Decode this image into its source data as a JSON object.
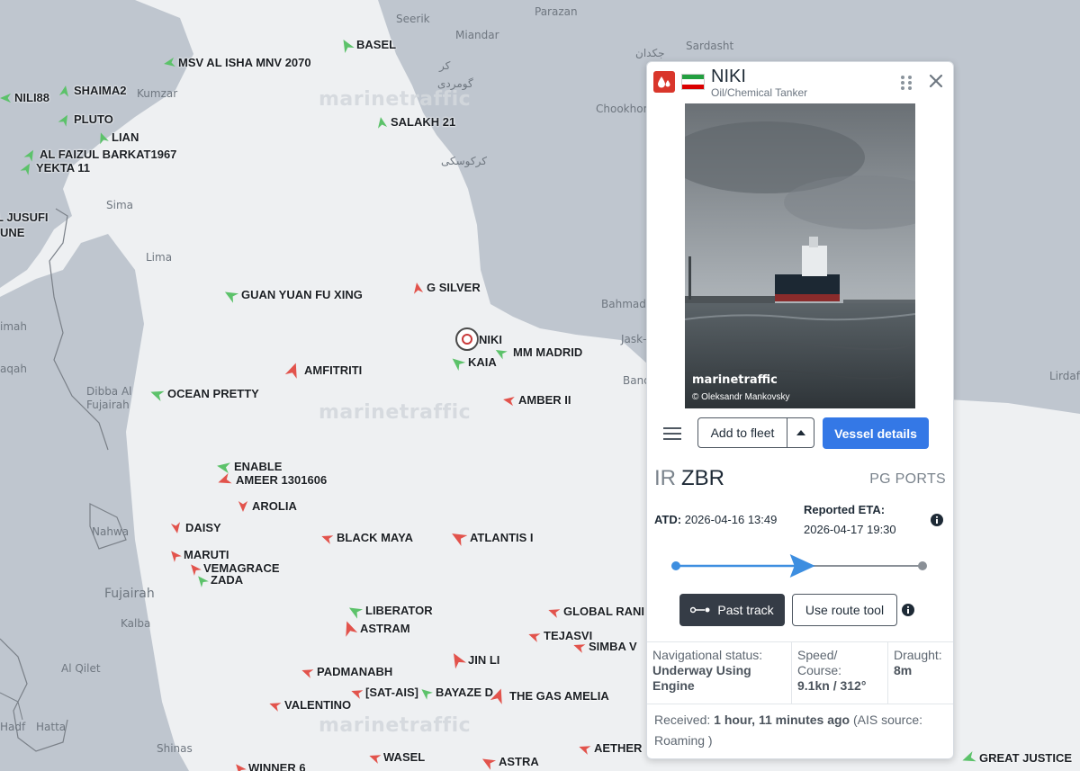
{
  "map": {
    "watermark_text": "marinetraffic",
    "places": [
      {
        "id": "seerik",
        "text": "Seerik"
      },
      {
        "id": "parazan",
        "text": "Parazan"
      },
      {
        "id": "miandar",
        "text": "Miandar"
      },
      {
        "id": "sardasht",
        "text": "Sardasht"
      },
      {
        "id": "jakdan",
        "text": "جکدان"
      },
      {
        "id": "kar",
        "text": "کر"
      },
      {
        "id": "goomardi",
        "text": "گومردی"
      },
      {
        "id": "kumzar",
        "text": "Kumzar"
      },
      {
        "id": "chookhon",
        "text": "Chookhon"
      },
      {
        "id": "kargasi",
        "text": "کرکوسکی"
      },
      {
        "id": "sima",
        "text": "Sima"
      },
      {
        "id": "lima",
        "text": "Lima"
      },
      {
        "id": "bahmadi",
        "text": "Bahmadi"
      },
      {
        "id": "jask",
        "text": "Jask-e"
      },
      {
        "id": "bande",
        "text": "Bande"
      },
      {
        "id": "lirdaf",
        "text": "Lirdaf"
      },
      {
        "id": "imah",
        "text": "imah"
      },
      {
        "id": "aqah",
        "text": "aqah"
      },
      {
        "id": "dibba",
        "text": "Dibba Al"
      },
      {
        "id": "dibba2",
        "text": "Fujairah"
      },
      {
        "id": "nahwa",
        "text": "Nahwa"
      },
      {
        "id": "fujairah",
        "text": "Fujairah"
      },
      {
        "id": "kalba",
        "text": "Kalba"
      },
      {
        "id": "alqilet",
        "text": "Al Qilet"
      },
      {
        "id": "hadf",
        "text": "Hadf"
      },
      {
        "id": "hatta",
        "text": "Hatta"
      },
      {
        "id": "shinas",
        "text": "Shinas"
      }
    ],
    "vessels": [
      {
        "name": "BASEL",
        "color": "#5cc26a"
      },
      {
        "name": "MSV AL ISHA MNV 2070",
        "color": "#5cc26a"
      },
      {
        "name": "NILI88",
        "color": "#5cc26a"
      },
      {
        "name": "SHAIMA2",
        "color": "#5cc26a"
      },
      {
        "name": "PLUTO",
        "color": "#5cc26a"
      },
      {
        "name": "LIAN",
        "color": "#5cc26a"
      },
      {
        "name": "AL FAIZUL BARKAT1967",
        "color": "#5cc26a"
      },
      {
        "name": "YEKTA 11",
        "color": "#5cc26a"
      },
      {
        "name": "SALAKH 21",
        "color": "#5cc26a"
      },
      {
        "name": "L JUSUFI",
        "color": "#5cc26a"
      },
      {
        "name": "UNE",
        "color": "#5cc26a"
      },
      {
        "name": "GUAN YUAN FU XING",
        "color": "#5cc26a"
      },
      {
        "name": "G SILVER",
        "color": "#e2534c"
      },
      {
        "name": "NIKI",
        "color": "#e2534c"
      },
      {
        "name": "MM MADRID",
        "color": "#5cc26a"
      },
      {
        "name": "KAIA",
        "color": "#5cc26a"
      },
      {
        "name": "AMFITRITI",
        "color": "#e2534c"
      },
      {
        "name": "OCEAN PRETTY",
        "color": "#5cc26a"
      },
      {
        "name": "AMBER II",
        "color": "#e2534c"
      },
      {
        "name": "ENABLE",
        "color": "#5cc26a"
      },
      {
        "name": "AMEER 1301606",
        "color": "#5cc26a"
      },
      {
        "name": "AROLIA",
        "color": "#e2534c"
      },
      {
        "name": "DAISY",
        "color": "#e2534c"
      },
      {
        "name": "BLACK MAYA",
        "color": "#e2534c"
      },
      {
        "name": "ATLANTIS I",
        "color": "#e2534c"
      },
      {
        "name": "MARUTI",
        "color": "#e2534c"
      },
      {
        "name": "VEMAGRACE",
        "color": "#e2534c"
      },
      {
        "name": "ZADA",
        "color": "#5cc26a"
      },
      {
        "name": "LIBERATOR",
        "color": "#5cc26a"
      },
      {
        "name": "GLOBAL RANI",
        "color": "#e2534c"
      },
      {
        "name": "ASTRAM",
        "color": "#e2534c"
      },
      {
        "name": "TEJASVI",
        "color": "#e2534c"
      },
      {
        "name": "SIMBA V",
        "color": "#e2534c"
      },
      {
        "name": "JIN LI",
        "color": "#e2534c"
      },
      {
        "name": "PADMANABH",
        "color": "#e2534c"
      },
      {
        "name": "[SAT-AIS]",
        "color": "#e2534c"
      },
      {
        "name": "BAYAZE D",
        "color": "#5cc26a"
      },
      {
        "name": "THE GAS AMELIA",
        "color": "#e2534c"
      },
      {
        "name": "VALENTINO",
        "color": "#e2534c"
      },
      {
        "name": "WASEL",
        "color": "#e2534c"
      },
      {
        "name": "ASTRA",
        "color": "#e2534c"
      },
      {
        "name": "AETHER",
        "color": "#e2534c"
      },
      {
        "name": "GREAT JUSTICE",
        "color": "#5cc26a"
      },
      {
        "name": "WINNER 6",
        "color": "#e2534c"
      }
    ]
  },
  "panel": {
    "vessel_name": "NIKI",
    "vessel_type": "Oil/Chemical Tanker",
    "photo_watermark": "marinetraffic",
    "photo_credit": "© Oleksandr Mankovsky",
    "add_to_fleet_label": "Add to fleet",
    "vessel_details_label": "Vessel details",
    "destination_country": "IR",
    "destination_port": "ZBR",
    "destination_region": "PG PORTS",
    "atd_label": "ATD:",
    "atd_value": "2026-04-16 13:49",
    "eta_label": "Reported ETA:",
    "eta_value": "2026-04-17 19:30",
    "voyage_progress": 0.55,
    "past_track_label": "Past track",
    "route_tool_label": "Use route tool",
    "nav_status_label": "Navigational status:",
    "nav_status_value": "Underway Using Engine",
    "speed_label": "Speed/ Course:",
    "speed_value": "9.1kn / 312°",
    "draught_label": "Draught:",
    "draught_value": "8m",
    "received_label": "Received:",
    "received_value": "1 hour, 11 minutes ago",
    "ais_source": "(AIS source: Roaming )",
    "colors": {
      "accent": "#3478e6",
      "dark_button": "#353c46",
      "tanker_red": "#d9362b"
    }
  }
}
